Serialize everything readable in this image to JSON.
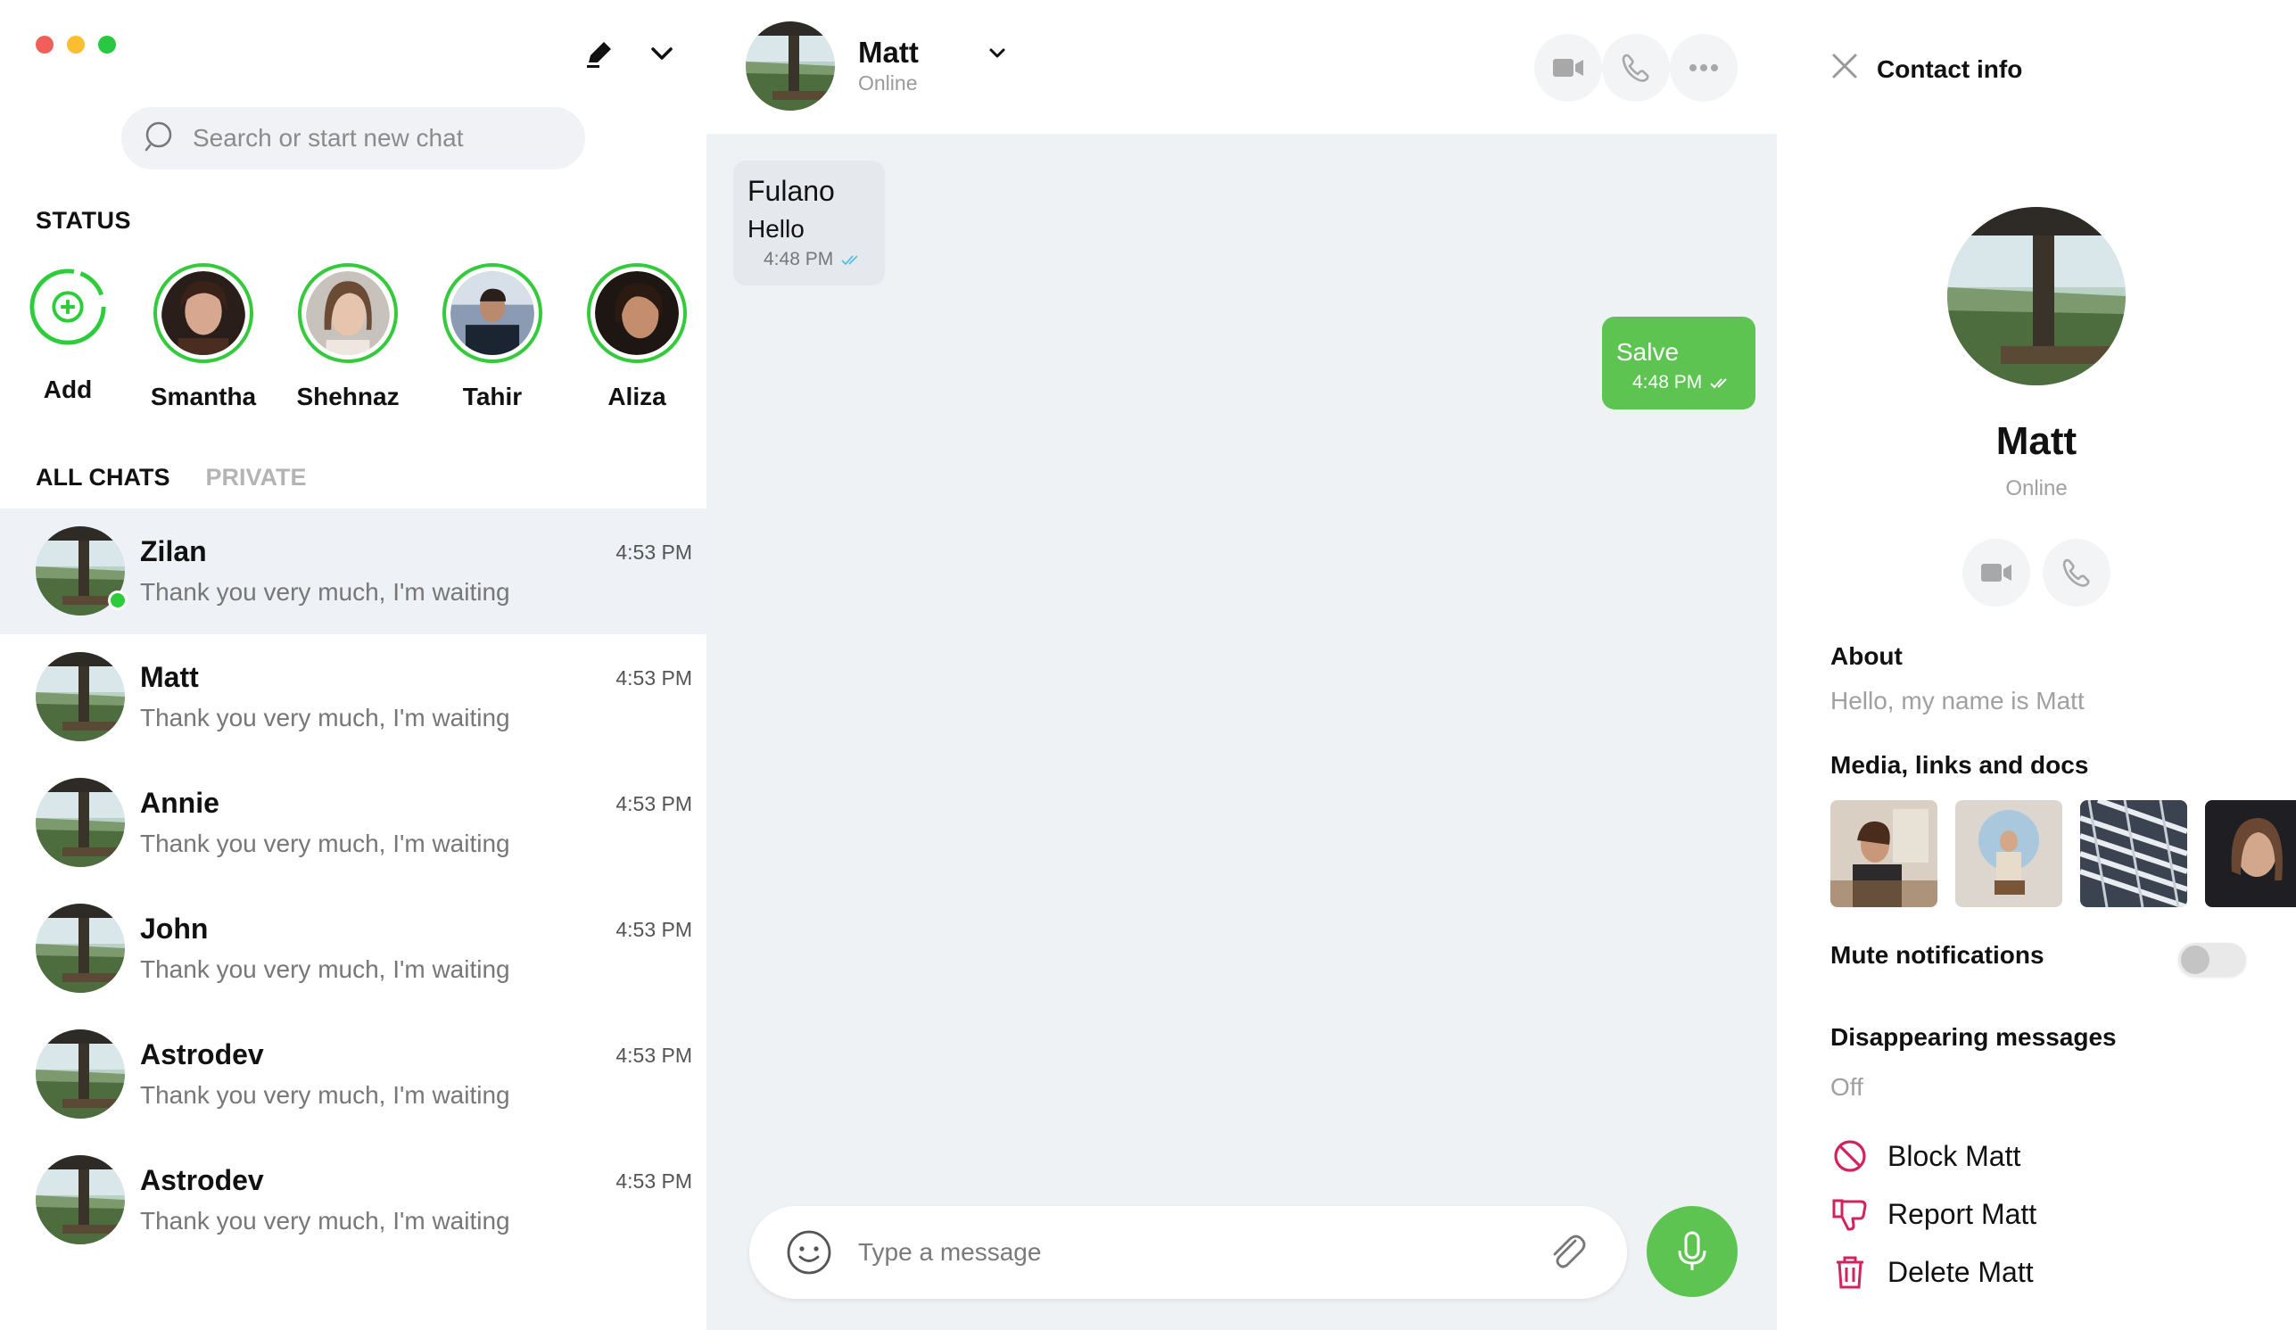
{
  "window": {
    "controls": [
      {
        "name": "close",
        "color": "#ff5f57"
      },
      {
        "name": "minimize",
        "color": "#febc2e"
      },
      {
        "name": "maximize",
        "color": "#28c840"
      }
    ]
  },
  "sidebar": {
    "compose_icon": "edit-icon",
    "menu_icon": "chevron-down-icon",
    "search": {
      "placeholder": "Search or start new chat",
      "value": ""
    },
    "status_title": "STATUS",
    "statuses": [
      {
        "name": "Add",
        "type": "add"
      },
      {
        "name": "Smantha"
      },
      {
        "name": "Shehnaz"
      },
      {
        "name": "Tahir"
      },
      {
        "name": "Aliza"
      }
    ],
    "tabs": {
      "all": "ALL CHATS",
      "private": "PRIVATE"
    },
    "chats": [
      {
        "name": "Zilan",
        "time": "4:53 PM",
        "message": "Thank you very much, I'm waiting",
        "selected": true,
        "online": true
      },
      {
        "name": "Matt",
        "time": "4:53 PM",
        "message": "Thank you very much, I'm waiting"
      },
      {
        "name": "Annie",
        "time": "4:53 PM",
        "message": "Thank you very much, I'm waiting"
      },
      {
        "name": "John",
        "time": "4:53 PM",
        "message": "Thank you very much, I'm waiting"
      },
      {
        "name": "Astrodev",
        "time": "4:53 PM",
        "message": "Thank you very much, I'm waiting"
      },
      {
        "name": "Astrodev",
        "time": "4:53 PM",
        "message": "Thank you very much, I'm waiting"
      }
    ]
  },
  "chat": {
    "contact_name": "Matt",
    "contact_status": "Online",
    "header_icons": [
      "video-icon",
      "phone-icon",
      "more-icon"
    ],
    "messages": [
      {
        "direction": "in",
        "sender": "Fulano",
        "text": "Hello",
        "time": "4:48 PM"
      },
      {
        "direction": "out",
        "text": "Salve",
        "time": "4:48 PM"
      }
    ],
    "composer": {
      "placeholder": "Type a message",
      "value": ""
    }
  },
  "info": {
    "title": "Contact info",
    "name": "Matt",
    "status": "Online",
    "about_label": "About",
    "about_text": "Hello, my name is Matt",
    "media_label": "Media, links and docs",
    "mute_label": "Mute notifications",
    "mute_on": false,
    "disappearing_label": "Disappearing messages",
    "disappearing_value": "Off",
    "actions": {
      "block": "Block Matt",
      "report": "Report Matt",
      "delete": "Delete Matt"
    }
  },
  "colors": {
    "accent": "#5dc452",
    "online": "#2dcc3a",
    "danger": "#d0245f",
    "panel_bg": "#eff2f5"
  }
}
